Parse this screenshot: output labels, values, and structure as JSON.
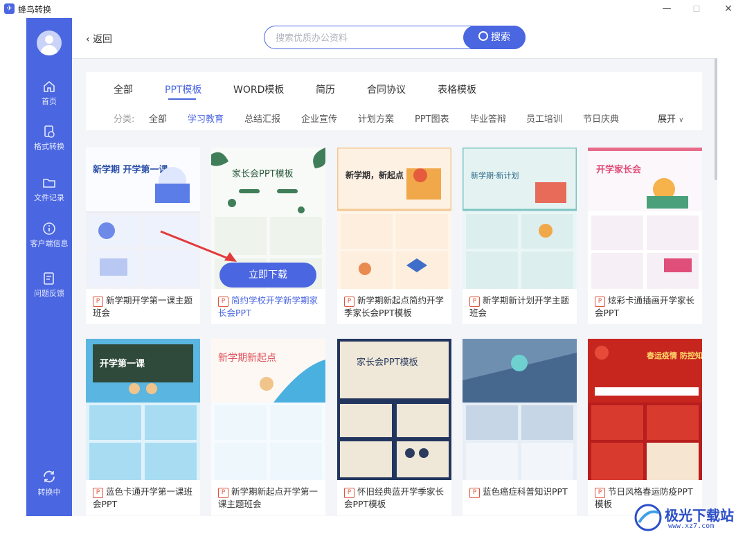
{
  "window": {
    "title": "蜂鸟转换",
    "min": "—",
    "max": "☐",
    "close": "✕"
  },
  "sidebar": {
    "items": [
      {
        "label": "首页",
        "icon": "home-icon"
      },
      {
        "label": "格式转换",
        "icon": "convert-icon"
      },
      {
        "label": "文件记录",
        "icon": "folder-icon"
      },
      {
        "label": "客户端信息",
        "icon": "info-icon"
      },
      {
        "label": "问题反馈",
        "icon": "feedback-icon"
      },
      {
        "label": "转换中",
        "icon": "refresh-icon"
      }
    ]
  },
  "topbar": {
    "back_label": "返回",
    "search_placeholder": "搜索优质办公资料",
    "search_button": "搜索"
  },
  "tabs": [
    "全部",
    "PPT模板",
    "WORD模板",
    "简历",
    "合同协议",
    "表格模板"
  ],
  "categories": {
    "label": "分类:",
    "items": [
      "全部",
      "学习教育",
      "总结汇报",
      "企业宣传",
      "计划方案",
      "PPT图表",
      "毕业答辩",
      "员工培训",
      "节日庆典"
    ],
    "expand": "展开"
  },
  "download_button": "立即下载",
  "badge": "P",
  "cards": [
    {
      "title": "新学期开学第一课主题班会",
      "thumb_text": "新学期 开学第一课"
    },
    {
      "title": "简约学校开学新学期家长会PPT",
      "thumb_text": "家长会PPT模板"
    },
    {
      "title": "新学期新起点简约开学季家长会PPT模板",
      "thumb_text": "新学期，新起点"
    },
    {
      "title": "新学期新计划开学主题班会",
      "thumb_text": "新学期·新计划"
    },
    {
      "title": "炫彩卡通插画开学家长会PPT",
      "thumb_text": "开学家长会"
    },
    {
      "title": "蓝色卡通开学第一课班会PPT",
      "thumb_text": "开学第一课"
    },
    {
      "title": "新学期新起点开学第一课主题班会",
      "thumb_text": "新学期新起点"
    },
    {
      "title": "怀旧经典蓝开学季家长会PPT模板",
      "thumb_text": "家长会PPT模板"
    },
    {
      "title": "蓝色癌症科普知识PPT",
      "thumb_text": ""
    },
    {
      "title": "节日风格春运防疫PPT模板",
      "thumb_text": "春运疫情 防控知识"
    }
  ],
  "watermark": {
    "text": "极光下载站",
    "url": "www.xz7.com"
  },
  "colors": {
    "accent": "#4a66e0",
    "badge": "#e0533b"
  }
}
